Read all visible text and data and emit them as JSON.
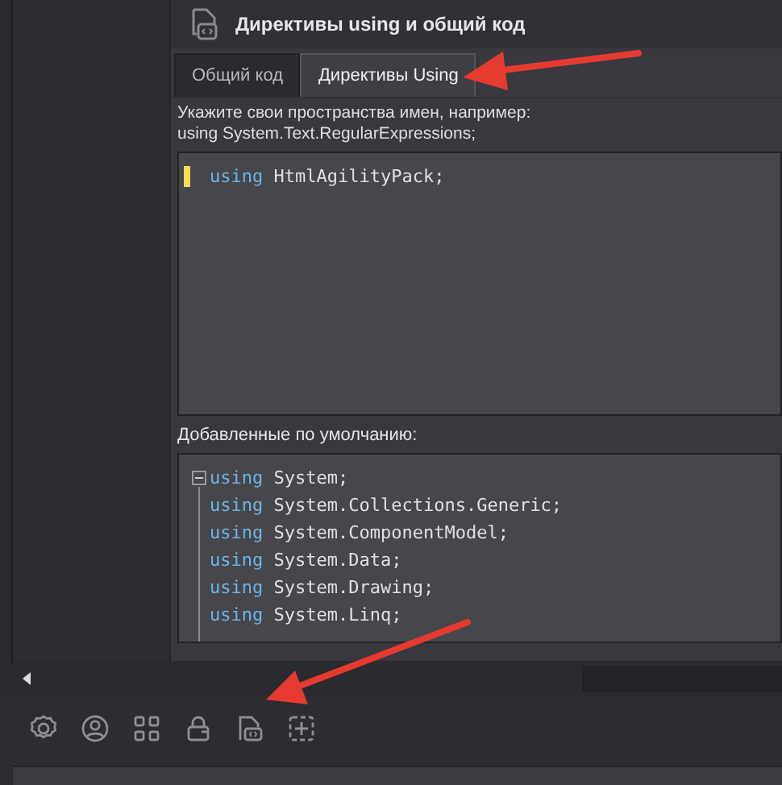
{
  "dialog": {
    "title": "Директивы using и общий код"
  },
  "tabs": [
    {
      "label": "Общий код",
      "selected": false
    },
    {
      "label": "Директивы Using",
      "selected": true
    }
  ],
  "hint": [
    "Укажите свои пространства имен, например:",
    "using System.Text.RegularExpressions;"
  ],
  "user_code": [
    {
      "keyword": "using",
      "rest": "HtmlAgilityPack;",
      "modified": true
    }
  ],
  "defaults_label": "Добавленные по умолчанию:",
  "default_code": [
    {
      "keyword": "using",
      "rest": "System;",
      "expanded": true
    },
    {
      "keyword": "using",
      "rest": "System.Collections.Generic;"
    },
    {
      "keyword": "using",
      "rest": "System.ComponentModel;"
    },
    {
      "keyword": "using",
      "rest": "System.Data;"
    },
    {
      "keyword": "using",
      "rest": "System.Drawing;"
    },
    {
      "keyword": "using",
      "rest": "System.Linq;"
    }
  ]
}
